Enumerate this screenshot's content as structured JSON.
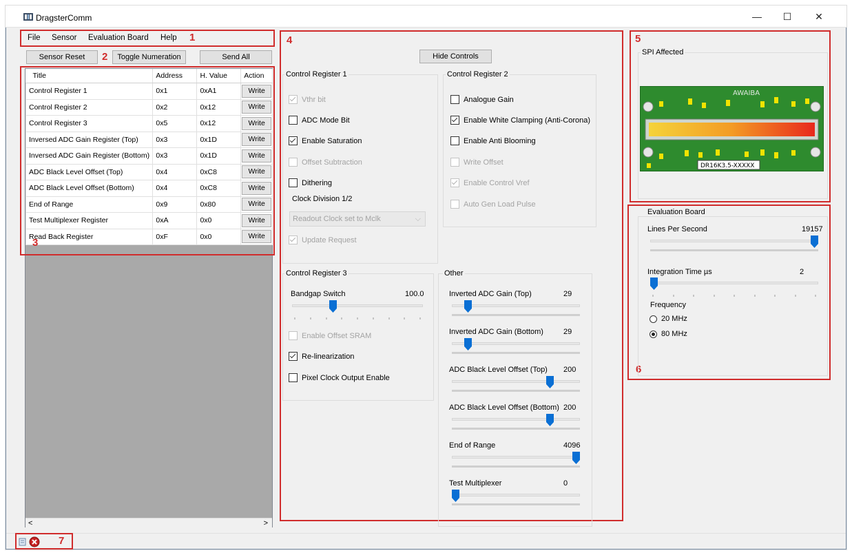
{
  "window": {
    "title": "DragsterComm",
    "min": "—",
    "max": "☐",
    "close": "✕"
  },
  "menu": {
    "file": "File",
    "sensor": "Sensor",
    "evaluation_board": "Evaluation Board",
    "help": "Help"
  },
  "toolbar": {
    "sensor_reset": "Sensor Reset",
    "toggle_numeration": "Toggle Numeration",
    "send_all": "Send All"
  },
  "annotations": {
    "n1": "1",
    "n2": "2",
    "n3": "3",
    "n4": "4",
    "n5": "5",
    "n6": "6",
    "n7": "7",
    "color": "#d02c2c"
  },
  "table": {
    "headers": {
      "title": "Title",
      "address": "Address",
      "hvalue": "H. Value",
      "action": "Action"
    },
    "rows": [
      {
        "title": "Control Register 1",
        "address": "0x1",
        "hvalue": "0xA1",
        "action": "Write"
      },
      {
        "title": "Control Register 2",
        "address": "0x2",
        "hvalue": "0x12",
        "action": "Write"
      },
      {
        "title": "Control Register 3",
        "address": "0x5",
        "hvalue": "0x12",
        "action": "Write"
      },
      {
        "title": "Inversed ADC Gain Register (Top)",
        "address": "0x3",
        "hvalue": "0x1D",
        "action": "Write"
      },
      {
        "title": "Inversed ADC Gain Register (Bottom)",
        "address": "0x3",
        "hvalue": "0x1D",
        "action": "Write"
      },
      {
        "title": "ADC Black Level Offset (Top)",
        "address": "0x4",
        "hvalue": "0xC8",
        "action": "Write"
      },
      {
        "title": "ADC Black Level Offset (Bottom)",
        "address": "0x4",
        "hvalue": "0xC8",
        "action": "Write"
      },
      {
        "title": "End of Range",
        "address": "0x9",
        "hvalue": "0x80",
        "action": "Write"
      },
      {
        "title": "Test Multiplexer Register",
        "address": "0xA",
        "hvalue": "0x0",
        "action": "Write"
      },
      {
        "title": "Read Back Register",
        "address": "0xF",
        "hvalue": "0x0",
        "action": "Write"
      }
    ],
    "scroll_left": "<",
    "scroll_right": ">"
  },
  "controls": {
    "hide_button": "Hide Controls",
    "cr1": {
      "title": "Control Register 1",
      "vthr": "Vthr bit",
      "adc_mode": "ADC Mode Bit",
      "enable_saturation": "Enable Saturation",
      "offset_subtraction": "Offset Subtraction",
      "dithering": "Dithering",
      "clock_division": "Clock Division 1/2",
      "clock_combo": "Readout Clock set to Mclk",
      "update_request": "Update Request"
    },
    "cr2": {
      "title": "Control Register 2",
      "analogue_gain": "Analogue Gain",
      "white_clamping": "Enable White Clamping (Anti-Corona)",
      "anti_blooming": "Enable Anti Blooming",
      "write_offset": "Write Offset",
      "control_vref": "Enable Control Vref",
      "auto_gen": "Auto Gen Load Pulse"
    },
    "cr3": {
      "title": "Control Register 3",
      "bandgap_label": "Bandgap Switch",
      "bandgap_value": "100.0",
      "bandgap_fraction": 0.3,
      "enable_offset_sram": "Enable Offset SRAM",
      "relinearization": "Re-linearization",
      "pixel_clock": "Pixel Clock Output Enable"
    },
    "other": {
      "title": "Other",
      "sliders": [
        {
          "label": "Inverted ADC Gain (Top)",
          "value": "29",
          "fraction": 0.1
        },
        {
          "label": "Inverted ADC Gain (Bottom)",
          "value": "29",
          "fraction": 0.1
        },
        {
          "label": "ADC Black Level Offset (Top)",
          "value": "200",
          "fraction": 0.78
        },
        {
          "label": "ADC Black Level Offset (Bottom)",
          "value": "200",
          "fraction": 0.78
        },
        {
          "label": "End of Range",
          "value": "4096",
          "fraction": 1.0
        },
        {
          "label": "Test Multiplexer",
          "value": "0",
          "fraction": 0.0
        }
      ]
    }
  },
  "spi": {
    "title": "SPI Affected",
    "chip_brand": "AWAIBA",
    "chip_model": "DR16K3.5-XXXXX"
  },
  "eval_board": {
    "title": "Evaluation Board",
    "lines_per_second_label": "Lines Per Second",
    "lines_per_second_value": "19157",
    "lines_fraction": 1.0,
    "integration_label": "Integration Time µs",
    "integration_value": "2",
    "integration_fraction": 0.0,
    "frequency_label": "Frequency",
    "f20": "20 MHz",
    "f80": "80 MHz"
  }
}
